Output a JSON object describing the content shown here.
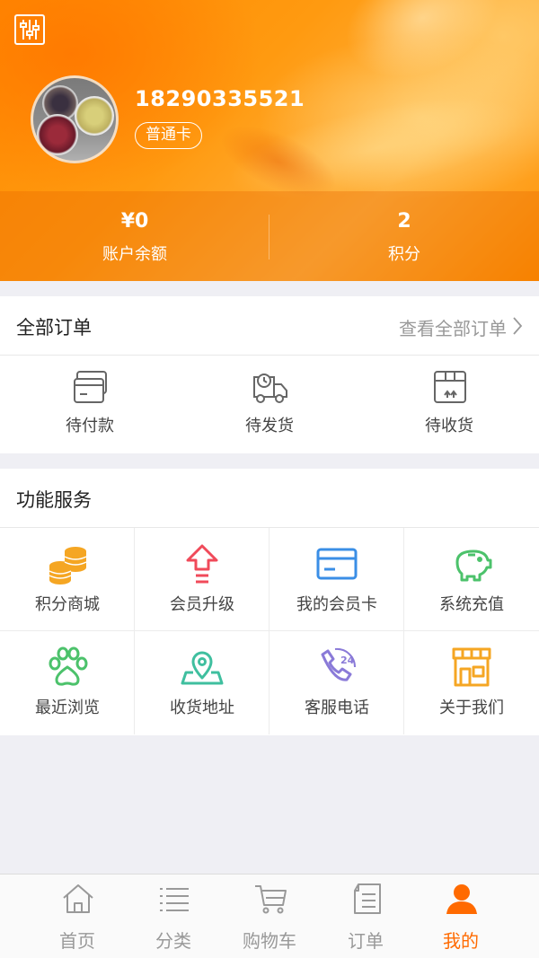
{
  "header": {
    "phone": "18290335521",
    "card_level": "普通卡",
    "balance_value": "¥0",
    "balance_label": "账户余额",
    "points_value": "2",
    "points_label": "积分"
  },
  "orders": {
    "title": "全部订单",
    "view_all": "查看全部订单",
    "items": [
      {
        "label": "待付款",
        "icon": "wallet-card-icon"
      },
      {
        "label": "待发货",
        "icon": "delivery-truck-icon"
      },
      {
        "label": "待收货",
        "icon": "package-box-icon"
      }
    ]
  },
  "services": {
    "title": "功能服务",
    "items": [
      {
        "label": "积分商城",
        "icon": "coins-icon",
        "color": "#f5a623"
      },
      {
        "label": "会员升级",
        "icon": "upgrade-arrow-icon",
        "color": "#f04a5a"
      },
      {
        "label": "我的会员卡",
        "icon": "member-card-icon",
        "color": "#3a8ee6"
      },
      {
        "label": "系统充值",
        "icon": "piggy-bank-icon",
        "color": "#4cc26b"
      },
      {
        "label": "最近浏览",
        "icon": "paw-icon",
        "color": "#4cc26b"
      },
      {
        "label": "收货地址",
        "icon": "map-pin-icon",
        "color": "#3fbf9f"
      },
      {
        "label": "客服电话",
        "icon": "phone-24-icon",
        "color": "#8a7ad8"
      },
      {
        "label": "关于我们",
        "icon": "storefront-icon",
        "color": "#f5a623"
      }
    ]
  },
  "tabbar": {
    "active_color": "#ff6a00",
    "items": [
      {
        "label": "首页",
        "icon": "home-icon"
      },
      {
        "label": "分类",
        "icon": "list-icon"
      },
      {
        "label": "购物车",
        "icon": "cart-icon"
      },
      {
        "label": "订单",
        "icon": "order-document-icon"
      },
      {
        "label": "我的",
        "icon": "user-icon"
      }
    ]
  }
}
